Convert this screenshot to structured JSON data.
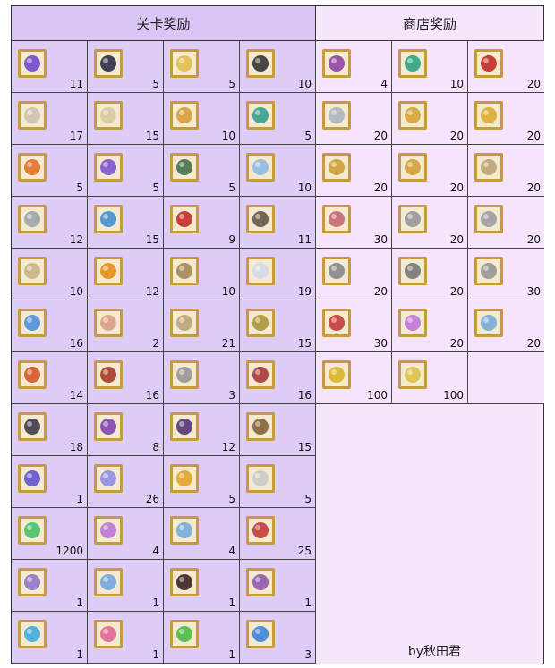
{
  "headers": {
    "stage": "关卡奖励",
    "shop": "商店奖励"
  },
  "stage_rewards": [
    {
      "icon": "purple-crystal-icon",
      "color": "#6a3fd0",
      "qty": "11"
    },
    {
      "icon": "dark-horn-icon",
      "color": "#222244",
      "qty": "5"
    },
    {
      "icon": "golden-horn-icon",
      "color": "#e0b84a",
      "qty": "5"
    },
    {
      "icon": "black-cauldron-icon",
      "color": "#2a2a2a",
      "qty": "10"
    },
    {
      "icon": "silver-urn-icon",
      "color": "#c9c2b0",
      "qty": "17"
    },
    {
      "icon": "pearl-gem-icon",
      "color": "#d8c8a0",
      "qty": "15"
    },
    {
      "icon": "golden-lamp-icon",
      "color": "#d09a30",
      "qty": "10"
    },
    {
      "icon": "peacock-jewel-icon",
      "color": "#2a9a8a",
      "qty": "5"
    },
    {
      "icon": "fire-feather-icon",
      "color": "#e06a20",
      "qty": "5"
    },
    {
      "icon": "amethyst-cluster-icon",
      "color": "#7a4ad0",
      "qty": "5"
    },
    {
      "icon": "dragon-wing-icon",
      "color": "#3a6a40",
      "qty": "5"
    },
    {
      "icon": "crystal-ball-icon",
      "color": "#8ab8e8",
      "qty": "10"
    },
    {
      "icon": "white-magatama-icon",
      "color": "#9aa0a8",
      "qty": "12"
    },
    {
      "icon": "blue-lantern-icon",
      "color": "#3a8ad0",
      "qty": "15"
    },
    {
      "icon": "red-potion-icon",
      "color": "#c02020",
      "qty": "9"
    },
    {
      "icon": "meteor-stone-icon",
      "color": "#5a5040",
      "qty": "11"
    },
    {
      "icon": "magic-scroll-icon",
      "color": "#c8b080",
      "qty": "10"
    },
    {
      "icon": "fire-core-icon",
      "color": "#e08a10",
      "qty": "12"
    },
    {
      "icon": "clockwork-gear-icon",
      "color": "#a08050",
      "qty": "10"
    },
    {
      "icon": "snow-crystal-icon",
      "color": "#d0d8e8",
      "qty": "19"
    },
    {
      "icon": "rainbow-crystal-icon",
      "color": "#4a8ae0",
      "qty": "16"
    },
    {
      "icon": "seashell-icon",
      "color": "#d89a80",
      "qty": "2"
    },
    {
      "icon": "dragon-scale-icon",
      "color": "#b8a070",
      "qty": "21"
    },
    {
      "icon": "golden-goblet-icon",
      "color": "#a89030",
      "qty": "15"
    },
    {
      "icon": "phoenix-claw-icon",
      "color": "#d05020",
      "qty": "14"
    },
    {
      "icon": "red-chain-icon",
      "color": "#a03020",
      "qty": "16"
    },
    {
      "icon": "grey-fang-icon",
      "color": "#909090",
      "qty": "3"
    },
    {
      "icon": "bone-icon",
      "color": "#a03030",
      "qty": "16"
    },
    {
      "icon": "black-claw-icon",
      "color": "#303040",
      "qty": "18"
    },
    {
      "icon": "purple-horn-icon",
      "color": "#7a3ab0",
      "qty": "8"
    },
    {
      "icon": "purple-shell-icon",
      "color": "#4a2a70",
      "qty": "12"
    },
    {
      "icon": "ancient-scepter-icon",
      "color": "#7a5a30",
      "qty": "15"
    },
    {
      "icon": "purple-cube-icon",
      "color": "#5a4ad0",
      "qty": "1"
    },
    {
      "icon": "star-shard-icon",
      "color": "#8a8ae8",
      "qty": "26"
    },
    {
      "icon": "golden-apple-icon",
      "color": "#e0a020",
      "qty": "5"
    },
    {
      "icon": "silver-apple-icon",
      "color": "#c8c8c8",
      "qty": "5"
    },
    {
      "icon": "green-gem-icon",
      "color": "#40c060",
      "qty": "1200"
    },
    {
      "icon": "servant-card-icon",
      "color": "#b870d8",
      "qty": "4"
    },
    {
      "icon": "craft-essence-card-icon",
      "color": "#70a8d8",
      "qty": "4"
    },
    {
      "icon": "red-card-icon",
      "color": "#c03030",
      "qty": "25"
    },
    {
      "icon": "chibi-servant-icon",
      "color": "#8a70c8",
      "qty": "1"
    },
    {
      "icon": "blue-swirl-icon",
      "color": "#6aa0e0",
      "qty": "1"
    },
    {
      "icon": "black-heart-icon",
      "color": "#301818",
      "qty": "1"
    },
    {
      "icon": "portrait-card-icon",
      "color": "#8a50b0",
      "qty": "1"
    },
    {
      "icon": "blue-key-icon",
      "color": "#30a8e0",
      "qty": "1"
    },
    {
      "icon": "pink-key-icon",
      "color": "#e06090",
      "qty": "1"
    },
    {
      "icon": "green-key-icon",
      "color": "#40b840",
      "qty": "1"
    },
    {
      "icon": "blue-ticket-icon",
      "color": "#3080d8",
      "qty": "3"
    }
  ],
  "shop_rewards": [
    {
      "icon": "purple-portrait-icon",
      "color": "#8a3aa0",
      "qty": "4"
    },
    {
      "icon": "green-necklace-icon",
      "color": "#20a080",
      "qty": "10"
    },
    {
      "icon": "red-drop-icon",
      "color": "#c02020",
      "qty": "20"
    },
    {
      "icon": "silver-pendant-icon",
      "color": "#a8b0c0",
      "qty": "20"
    },
    {
      "icon": "gold-statue-icon",
      "color": "#d0a030",
      "qty": "20"
    },
    {
      "icon": "gold-statue-icon",
      "color": "#d8a828",
      "qty": "20"
    },
    {
      "icon": "gold-statue-icon",
      "color": "#c89a30",
      "qty": "20"
    },
    {
      "icon": "golden-lamp-icon",
      "color": "#d09a30",
      "qty": "20"
    },
    {
      "icon": "dragon-scale-icon",
      "color": "#b8a070",
      "qty": "20"
    },
    {
      "icon": "pink-horn-icon",
      "color": "#c06070",
      "qty": "30"
    },
    {
      "icon": "silver-statue-icon",
      "color": "#909098",
      "qty": "20"
    },
    {
      "icon": "silver-statue-icon",
      "color": "#9898a0",
      "qty": "20"
    },
    {
      "icon": "silver-statue-icon",
      "color": "#808088",
      "qty": "20"
    },
    {
      "icon": "steel-ring-icon",
      "color": "#707070",
      "qty": "20"
    },
    {
      "icon": "grey-fang-icon",
      "color": "#909090",
      "qty": "30"
    },
    {
      "icon": "red-feather-icon",
      "color": "#c03030",
      "qty": "30"
    },
    {
      "icon": "servant-card-icon",
      "color": "#b870d8",
      "qty": "20"
    },
    {
      "icon": "craft-essence-card-icon",
      "color": "#70a8d8",
      "qty": "20"
    },
    {
      "icon": "gold-servant-card-icon",
      "color": "#d8b020",
      "qty": "100"
    },
    {
      "icon": "gold-craft-card-icon",
      "color": "#d8c040",
      "qty": "100"
    }
  ],
  "credit": "by秋田君"
}
